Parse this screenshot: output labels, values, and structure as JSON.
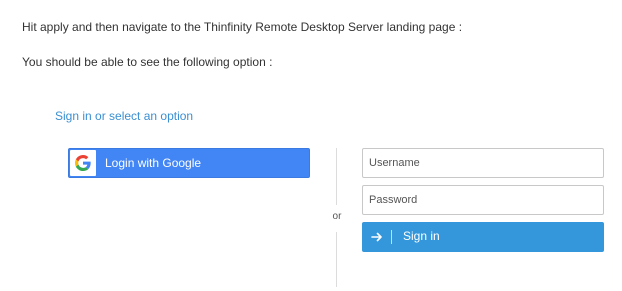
{
  "instructions": {
    "line1": "Hit apply and then navigate to the Thinfinity Remote Desktop Server landing page :",
    "line2": "You should be able to see the following option :"
  },
  "login": {
    "header": "Sign in or select an option",
    "google_button_label": "Login with Google",
    "divider_text": "or",
    "username_placeholder": "Username",
    "password_placeholder": "Password",
    "signin_button_label": "Sign in",
    "icons": {
      "google": "google-g-icon",
      "signin": "arrow-right-icon"
    },
    "colors": {
      "header_text": "#3a8fd2",
      "google_button": "#4285f4",
      "signin_button": "#3497db"
    }
  }
}
